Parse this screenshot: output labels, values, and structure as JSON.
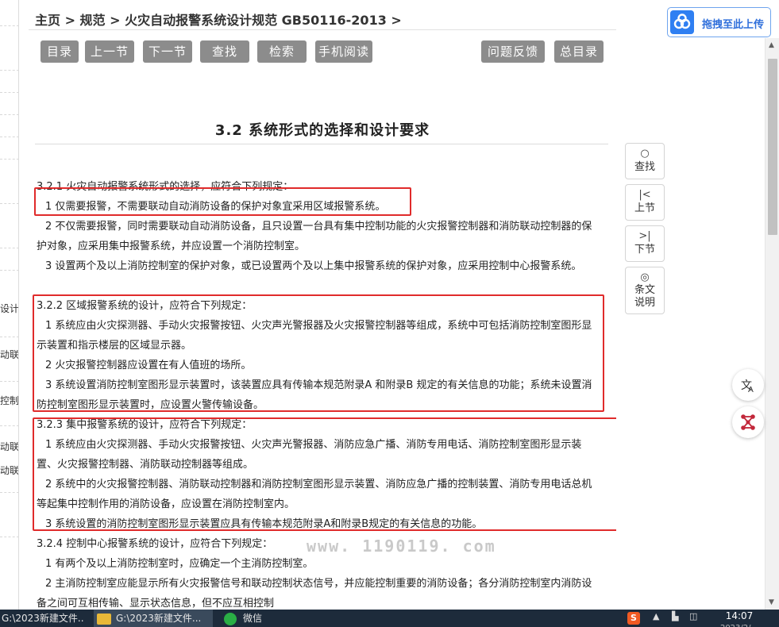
{
  "left_sidebar": {
    "fragments": [
      "设计",
      "动联",
      "控制",
      "动联",
      "动联"
    ]
  },
  "breadcrumb": {
    "text": "主页 > 规范 > 火灾自动报警系统设计规范 GB50116-2013 >"
  },
  "nav_buttons": {
    "toc": "目录",
    "prev": "上一节",
    "next": "下一节",
    "find": "查找",
    "search": "检索",
    "mobile": "手机阅读",
    "feedback": "问题反馈",
    "master_toc": "总目录"
  },
  "section": {
    "title": "3.2 系统形式的选择和设计要求",
    "paragraphs": [
      "3.2.1 火灾自动报警系统形式的选择，应符合下列规定：",
      "1 仅需要报警，不需要联动自动消防设备的保护对象宜采用区域报警系统。",
      "2 不仅需要报警，同时需要联动自动消防设备，且只设置一台具有集中控制功能的火灾报警控制器和消防联动控制器的保护对象，应采用集中报警系统，并应设置一个消防控制室。",
      "3 设置两个及以上消防控制室的保护对象，或已设置两个及以上集中报警系统的保护对象，应采用控制中心报警系统。",
      "3.2.2 区域报警系统的设计，应符合下列规定：",
      "1 系统应由火灾探测器、手动火灾报警按钮、火灾声光警报器及火灾报警控制器等组成，系统中可包括消防控制室图形显示装置和指示楼层的区域显示器。",
      "2 火灾报警控制器应设置在有人值班的场所。",
      "3 系统设置消防控制室图形显示装置时，该装置应具有传输本规范附录A 和附录B 规定的有关信息的功能；系统未设置消防控制室图形显示装置时，应设置火警传输设备。",
      "3.2.3 集中报警系统的设计，应符合下列规定：",
      "1 系统应由火灾探测器、手动火灾报警按钮、火灾声光警报器、消防应急广播、消防专用电话、消防控制室图形显示装置、火灾报警控制器、消防联动控制器等组成。",
      "2 系统中的火灾报警控制器、消防联动控制器和消防控制室图形显示装置、消防应急广播的控制装置、消防专用电话总机等起集中控制作用的消防设备，应设置在消防控制室内。",
      "3 系统设置的消防控制室图形显示装置应具有传输本规范附录A和附录B规定的有关信息的功能。",
      "3.2.4 控制中心报警系统的设计，应符合下列规定：",
      "1 有两个及以上消防控制室时，应确定一个主消防控制室。",
      "2 主消防控制室应能显示所有火灾报警信号和联动控制状态信号，并应能控制重要的消防设备；各分消防控制室内消防设备之间可互相传输、显示状态信息，但不应互相控制"
    ]
  },
  "watermark": "www. 1190119. com",
  "tools": {
    "find": "查找",
    "prev": "上节",
    "next": "下节",
    "explain": "条文说明",
    "find_icon": "magnifier-icon",
    "prev_icon": "skip-prev-icon",
    "next_icon": "skip-next-icon",
    "explain_icon": "eye-icon"
  },
  "upload": {
    "label": "拖拽至此上传",
    "icon": "cloud-icon"
  },
  "taskbar": {
    "item1": "G:\\2023新建文件...",
    "item2": "G:\\2023新建文件...",
    "item3": "微信",
    "time": "14:07",
    "date_partial": "2023/2/..."
  },
  "colors": {
    "highlight_box": "#e02b2b",
    "nav_button_bg": "#8c8c8c",
    "upload_accent": "#2f7ff2",
    "taskbar_bg": "#1d2b3b"
  }
}
